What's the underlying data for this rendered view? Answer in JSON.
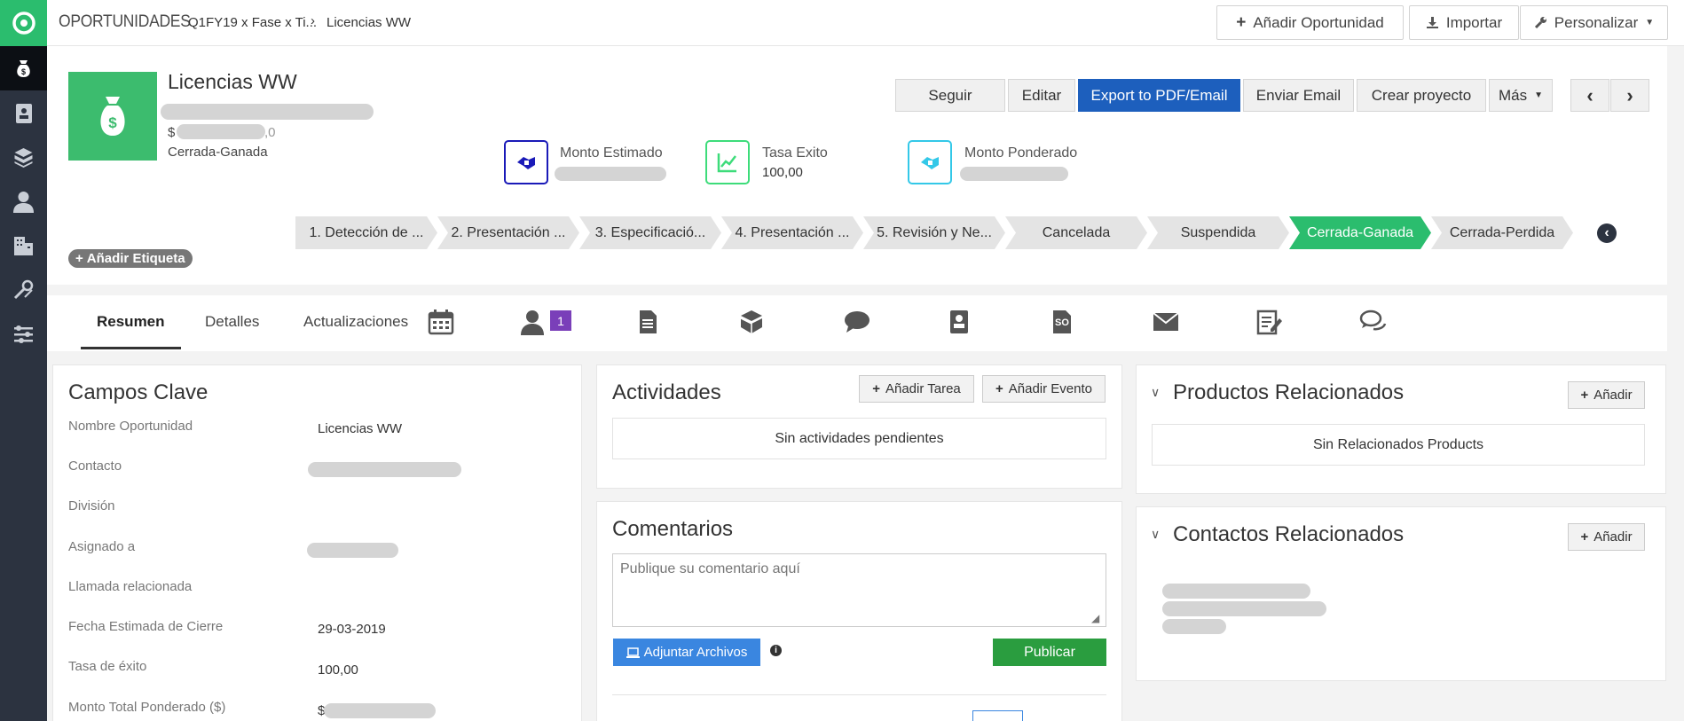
{
  "topbar": {
    "module": "OPORTUNIDADES",
    "breadcrumb": [
      "Q1FY19 x Fase x Ti...",
      "Licencias WW"
    ],
    "buttons": {
      "add": "Añadir Oportunidad",
      "import": "Importar",
      "customize": "Personalizar"
    }
  },
  "sidebar": {
    "items": [
      "logo-icon",
      "money-bag-icon",
      "address-book-icon",
      "boxes-icon",
      "user-icon",
      "building-icon",
      "tools-icon",
      "sliders-icon"
    ]
  },
  "record": {
    "title": "Licencias WW",
    "amount_prefix": "$",
    "amount_suffix": ",0",
    "stage": "Cerrada-Ganada",
    "add_tag": "Añadir Etiqueta"
  },
  "actions": [
    "Seguir",
    "Editar",
    "Export to PDF/Email",
    "Enviar Email",
    "Crear proyecto",
    "Más"
  ],
  "kpis": [
    {
      "label": "Monto Estimado",
      "value": "",
      "color": "#1a1ab8"
    },
    {
      "label": "Tasa Exito",
      "value": "100,00",
      "color": "#3ddc7a"
    },
    {
      "label": "Monto Ponderado",
      "value": "",
      "color": "#33c8e8"
    }
  ],
  "stages": [
    "1. Detección de ...",
    "2. Presentación ...",
    "3. Especificació...",
    "4. Presentación ...",
    "5. Revisión y Ne...",
    "Cancelada",
    "Suspendida",
    "Cerrada-Ganada",
    "Cerrada-Perdida"
  ],
  "current_stage_index": 7,
  "tabs": {
    "summary": "Resumen",
    "details": "Detalles",
    "updates": "Actualizaciones",
    "contacts_count": "1"
  },
  "key_fields": {
    "title": "Campos Clave",
    "rows": [
      {
        "label": "Nombre Oportunidad",
        "value": "Licencias WW"
      },
      {
        "label": "Contacto",
        "value": ""
      },
      {
        "label": "División",
        "value": ""
      },
      {
        "label": "Asignado a",
        "value": ""
      },
      {
        "label": "Llamada relacionada",
        "value": ""
      },
      {
        "label": "Fecha Estimada de Cierre",
        "value": "29-03-2019"
      },
      {
        "label": "Tasa de éxito",
        "value": "100,00"
      },
      {
        "label": "Monto Total Ponderado ($)",
        "value": "$"
      }
    ]
  },
  "activities": {
    "title": "Actividades",
    "add_task": "Añadir Tarea",
    "add_event": "Añadir Evento",
    "empty": "Sin actividades pendientes"
  },
  "comments": {
    "title": "Comentarios",
    "placeholder": "Publique su comentario aquí",
    "attach": "Adjuntar Archivos",
    "publish": "Publicar"
  },
  "products": {
    "title": "Productos Relacionados",
    "add": "Añadir",
    "empty": "Sin Relacionados Products"
  },
  "contacts": {
    "title": "Contactos Relacionados",
    "add": "Añadir"
  }
}
